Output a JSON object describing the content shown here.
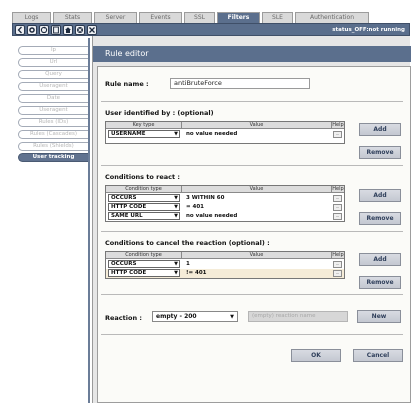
{
  "tabs": [
    "Logs",
    "Stats",
    "Server",
    "Events",
    "SSL",
    "Filters",
    "SLE",
    "Authentication"
  ],
  "active_tab_index": 5,
  "toolbar": {
    "status": "status_OFF:not running",
    "icons": [
      "back-icon",
      "stop-icon",
      "refresh-icon",
      "new-document-icon",
      "home-icon",
      "delete-icon",
      "close-icon"
    ]
  },
  "sidebar": {
    "items": [
      "Ip",
      "Url",
      "Query",
      "Useragent",
      "Date",
      "Useragent",
      "Rules (IDs)",
      "Rules (Cascades)",
      "Rules (Shields)",
      "User tracking"
    ],
    "active_index": 9
  },
  "editor": {
    "title": "Rule editor",
    "rule_name_label": "Rule name :",
    "rule_name_value": "antiBruteForce",
    "user_identified": {
      "title": "User identified by : (optional)",
      "headers": [
        "Key type",
        "Value",
        "Help"
      ],
      "rows": [
        {
          "type": "USERNAME",
          "value": "no value needed"
        }
      ],
      "add_label": "Add",
      "remove_label": "Remove"
    },
    "conditions": {
      "title": "Conditions to react :",
      "headers": [
        "Condition type",
        "Value",
        "Help"
      ],
      "rows": [
        {
          "type": "OCCURS",
          "value": "3 WITHIN 60"
        },
        {
          "type": "HTTP CODE",
          "value": "= 401"
        },
        {
          "type": "SAME URL",
          "value": "no value needed"
        }
      ],
      "add_label": "Add",
      "remove_label": "Remove"
    },
    "cancel_conditions": {
      "title": "Conditions to cancel the reaction (optional) :",
      "headers": [
        "Condition type",
        "Value",
        "Help"
      ],
      "rows": [
        {
          "type": "OCCURS",
          "value": "1"
        },
        {
          "type": "HTTP CODE",
          "value": "!= 401"
        }
      ],
      "add_label": "Add",
      "remove_label": "Remove"
    },
    "reaction_label": "Reaction :",
    "reaction_value": "empty - 200",
    "reaction_field_placeholder": "(empty) reaction name",
    "new_label": "New",
    "ok_label": "OK",
    "cancel_label": "Cancel"
  }
}
